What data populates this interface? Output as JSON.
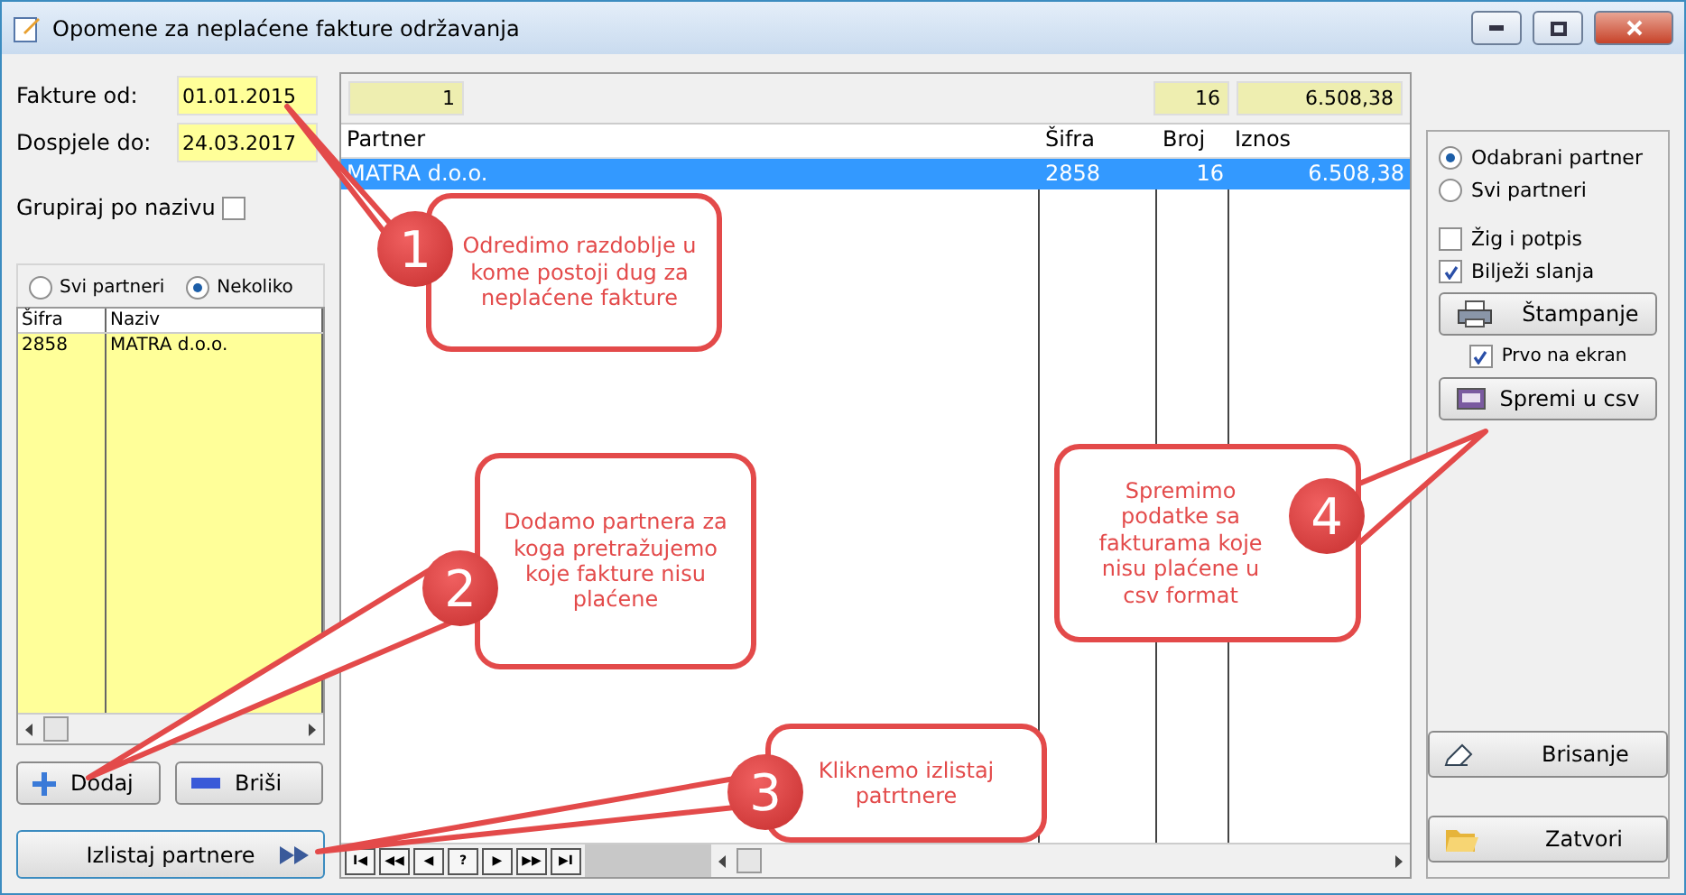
{
  "window": {
    "title": "Opomene za neplaćene fakture održavanja"
  },
  "filters": {
    "from_label": "Fakture od:",
    "from_value": "01.01.2015",
    "to_label": "Dospjele do:",
    "to_value": "24.03.2017",
    "group_label": "Grupiraj po nazivu",
    "group_checked": false
  },
  "partner_scope": [
    {
      "label": "Svi partneri",
      "selected": false
    },
    {
      "label": "Nekoliko",
      "selected": true
    }
  ],
  "partner_list": {
    "columns": [
      "Šifra",
      "Naziv"
    ],
    "rows": [
      [
        "2858",
        "MATRA d.o.o."
      ]
    ]
  },
  "left_buttons": [
    {
      "label": "Dodaj",
      "kind": "add"
    },
    {
      "label": "Briši",
      "kind": "remove"
    }
  ],
  "list_button": {
    "label": "Izlistaj partnere"
  },
  "totals": {
    "count": "1",
    "broj": "16",
    "iznos": "6.508,38"
  },
  "grid": {
    "columns": [
      "Partner",
      "Šifra",
      "Broj",
      "Iznos"
    ],
    "rows": [
      {
        "cells": [
          "MATRA d.o.o.",
          "2858",
          "16",
          "6.508,38"
        ],
        "selected": true
      }
    ]
  },
  "nav_buttons": [
    "I◀",
    "◀◀",
    "◀",
    "?",
    "▶",
    "▶▶",
    "▶I"
  ],
  "report_scope": [
    {
      "label": "Odabrani partner",
      "selected": true
    },
    {
      "label": "Svi partneri",
      "selected": false
    }
  ],
  "options": [
    {
      "label": "Žig i potpis",
      "checked": false
    },
    {
      "label": "Bilježi slanja",
      "checked": true
    }
  ],
  "print_button": {
    "label": "Štampanje"
  },
  "screen_first": {
    "label": "Prvo na ekran",
    "checked": true
  },
  "csv_button": {
    "label": "Spremi u csv"
  },
  "bottom_buttons": [
    {
      "label": "Brisanje",
      "kind": "erase"
    },
    {
      "label": "Zatvori",
      "kind": "close"
    }
  ],
  "callouts": [
    {
      "number": "1",
      "text": "Odredimo razdoblje u kome postoji dug za neplaćene fakture"
    },
    {
      "number": "2",
      "text": "Dodamo partnera za koga pretražujemo koje fakture nisu plaćene"
    },
    {
      "number": "3",
      "text": "Kliknemo izlistaj patrtnere"
    },
    {
      "number": "4",
      "text": "Spremimo podatke sa fakturama koje nisu plaćene u csv format"
    }
  ]
}
